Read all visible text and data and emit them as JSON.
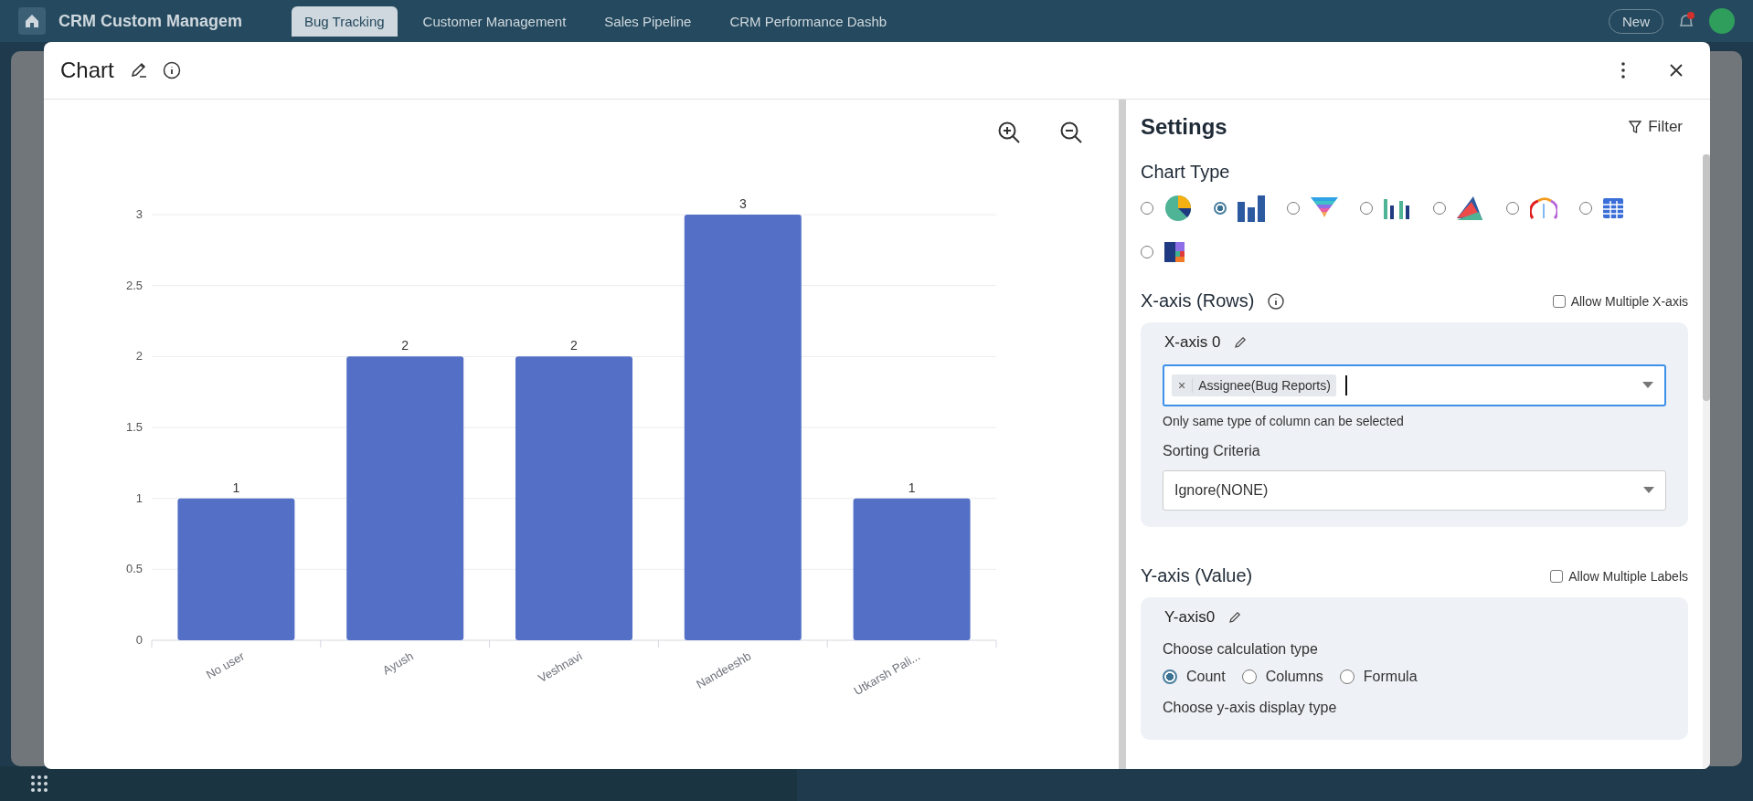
{
  "backdrop": {
    "app_title": "CRM Custom Managem",
    "tabs": [
      {
        "label": "Bug Tracking",
        "selected": true
      },
      {
        "label": "Customer Management",
        "selected": false
      },
      {
        "label": "Sales Pipeline",
        "selected": false
      },
      {
        "label": "CRM Performance Dashb",
        "selected": false
      }
    ],
    "new_button": "New"
  },
  "dialog": {
    "title": "Chart"
  },
  "chart": {
    "chart_data": {
      "type": "bar",
      "categories": [
        "No user",
        "Ayush",
        "Veshnavi",
        "Nandeeshb",
        "Utkarsh Pali..."
      ],
      "series": [
        {
          "color": "#5470c6",
          "values": [
            1,
            2,
            2,
            3,
            1
          ]
        }
      ],
      "ylim": [
        0,
        3
      ],
      "grid": true,
      "yticks": [
        0,
        {
          "value": 0.5,
          "label": "0.5"
        },
        1,
        {
          "value": 1.5,
          "label": "1.5"
        },
        2,
        {
          "value": 2.5,
          "label": "2.5"
        },
        3
      ],
      "data_labels": true
    }
  },
  "settings": {
    "title": "Settings",
    "filter": "Filter",
    "chart_type_label": "Chart Type",
    "chart_types": [
      {
        "kind": "pie",
        "selected": false
      },
      {
        "kind": "bar",
        "selected": true
      },
      {
        "kind": "funnel",
        "selected": false
      },
      {
        "kind": "grouped",
        "selected": false
      },
      {
        "kind": "area",
        "selected": false
      },
      {
        "kind": "gauge",
        "selected": false
      },
      {
        "kind": "table",
        "selected": false
      },
      {
        "kind": "treemap",
        "selected": false
      }
    ],
    "x_axis": {
      "title": "X-axis (Rows)",
      "allow_multiple": {
        "label": "Allow Multiple X-axis",
        "checked": false
      },
      "name": "X-axis 0",
      "chips": [
        {
          "remove": "×",
          "label": "Assignee(Bug Reports)"
        }
      ],
      "hint": "Only same type of column can be selected",
      "sorting_label": "Sorting Criteria",
      "sorting_value": "Ignore(NONE)"
    },
    "y_axis": {
      "title": "Y-axis (Value)",
      "allow_multiple": {
        "label": "Allow Multiple Labels",
        "checked": false
      },
      "name": "Y-axis0",
      "calc_label": "Choose calculation type",
      "calc_options": [
        {
          "label": "Count",
          "selected": true
        },
        {
          "label": "Columns",
          "selected": false
        },
        {
          "label": "Formula",
          "selected": false
        }
      ],
      "display_label": "Choose y-axis display type"
    }
  }
}
